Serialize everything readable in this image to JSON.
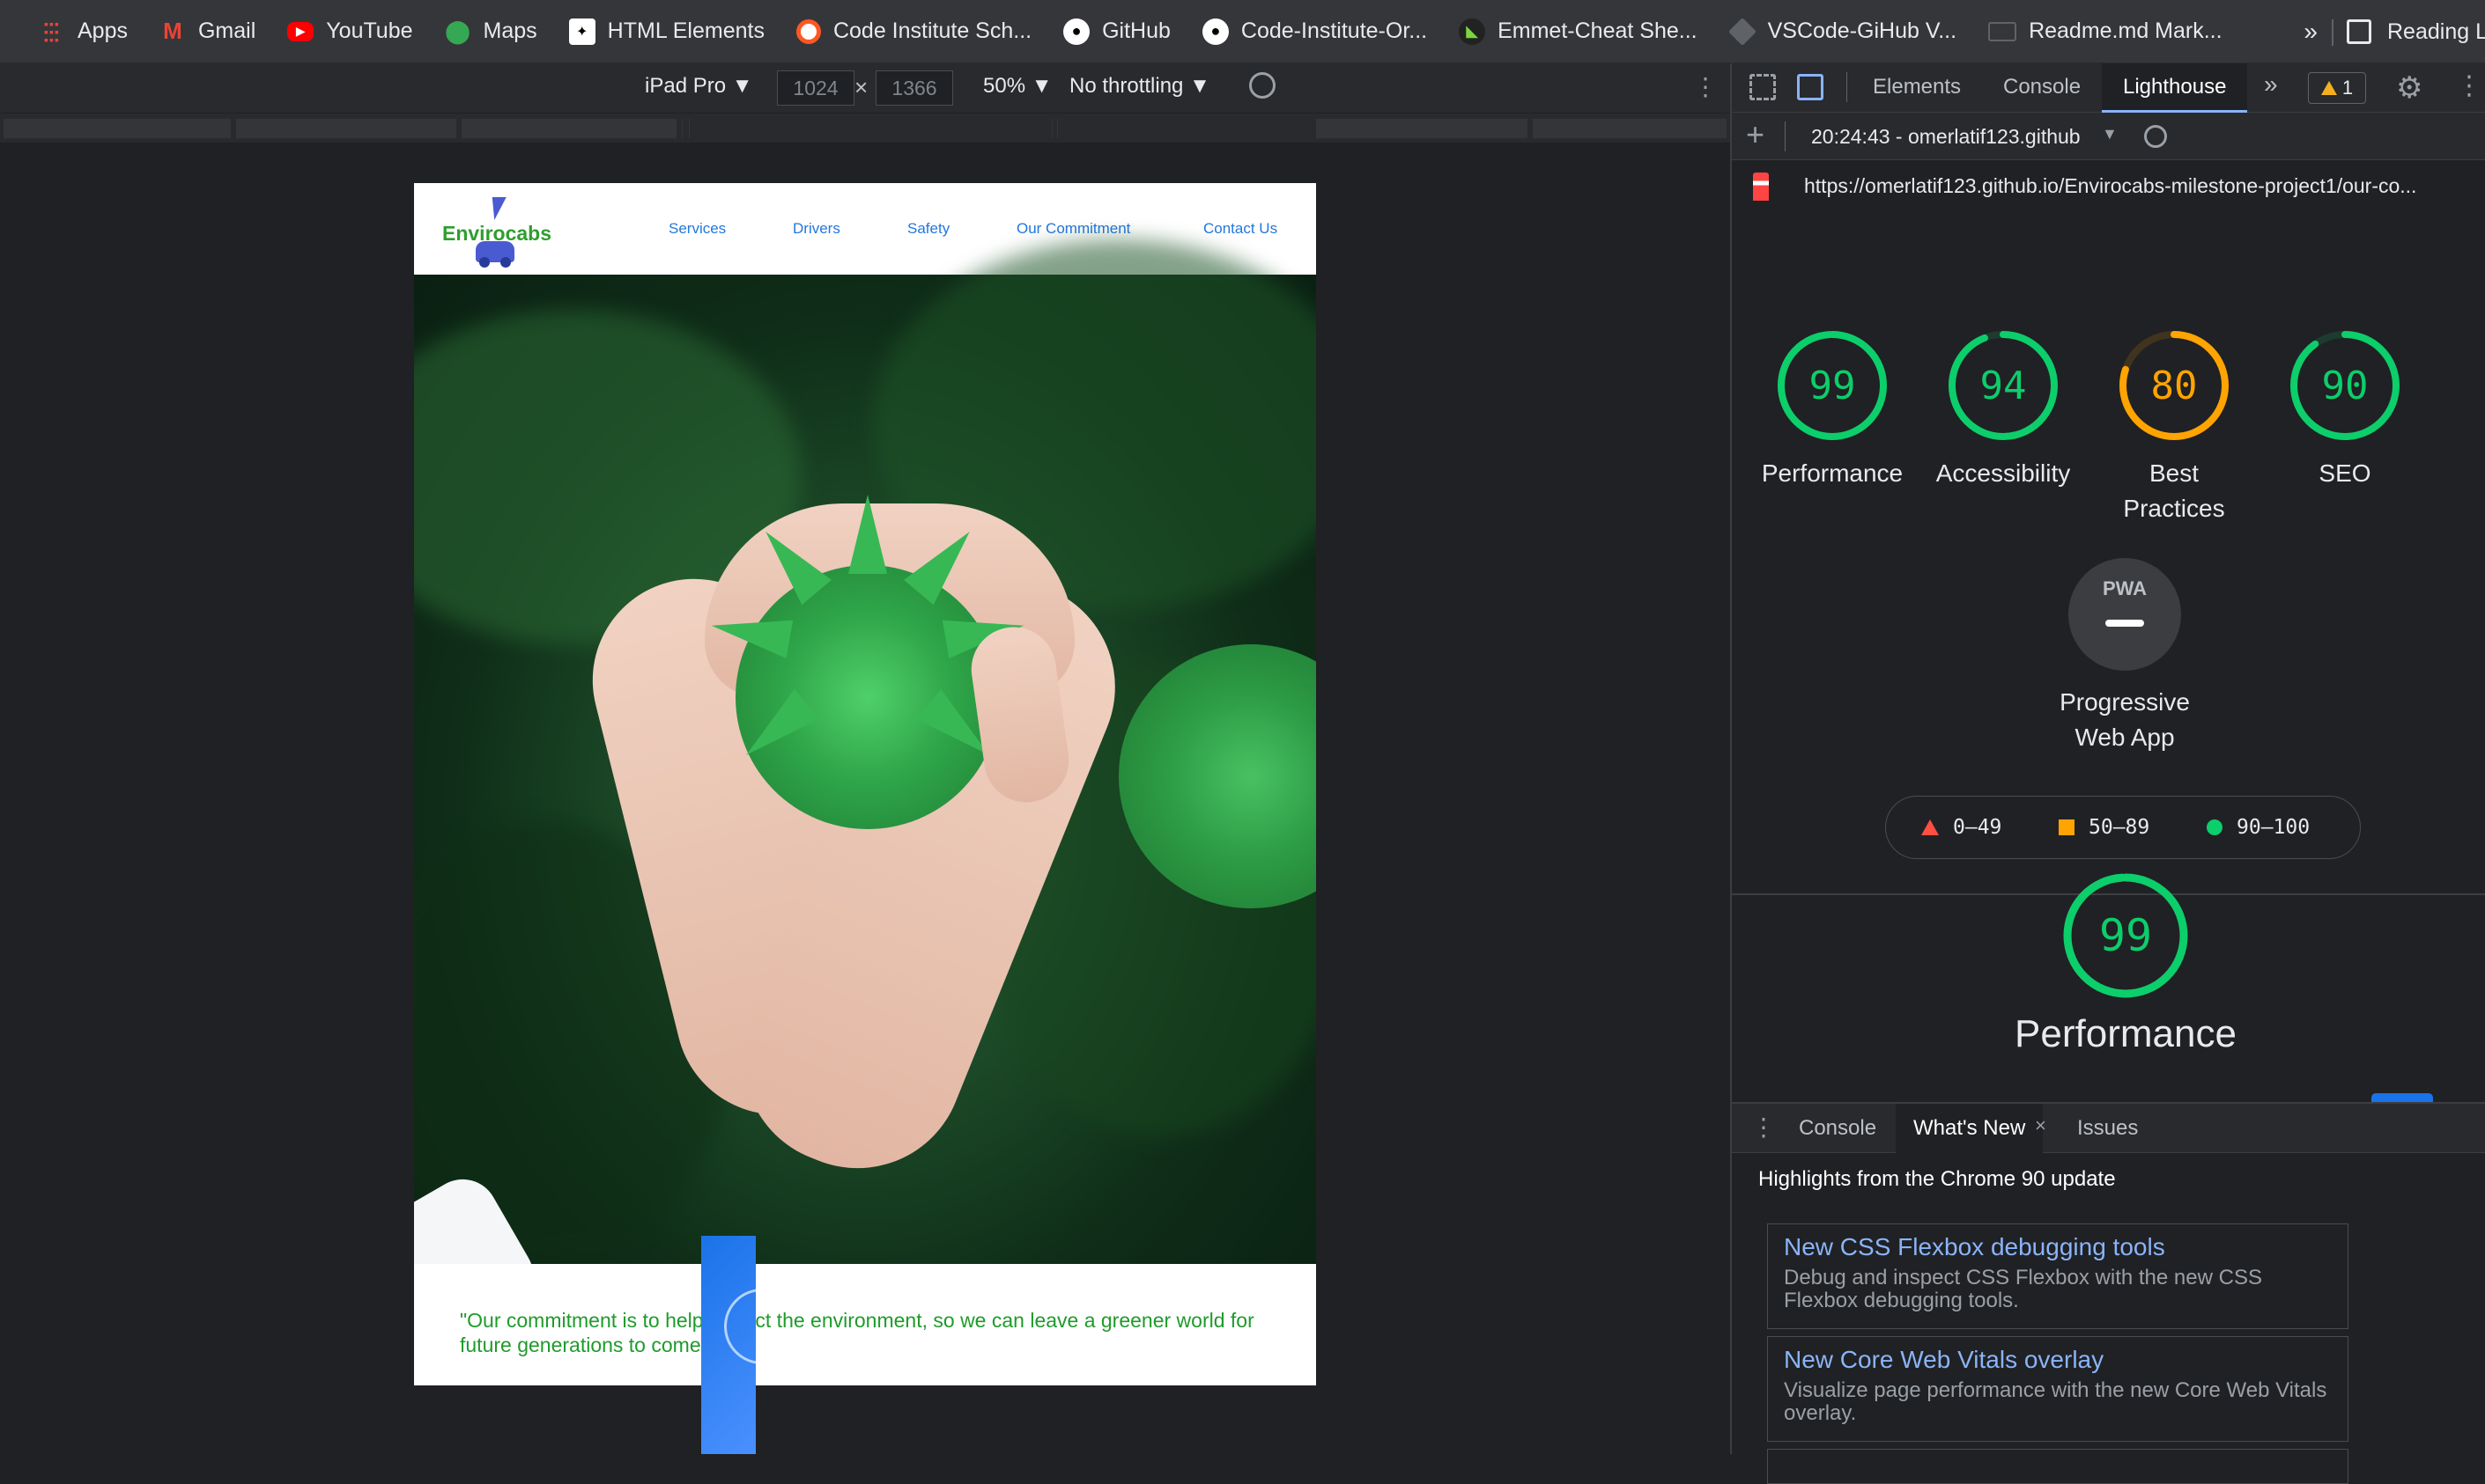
{
  "bookmarks": {
    "items": [
      {
        "label": "Apps",
        "icon": "apps-grid-icon",
        "color": "#ea4335"
      },
      {
        "label": "Gmail",
        "icon": "gmail-icon",
        "color": "#ea4335"
      },
      {
        "label": "YouTube",
        "icon": "youtube-icon",
        "color": "#ff0000"
      },
      {
        "label": "Maps",
        "icon": "maps-pin-icon",
        "color": "#34a853"
      },
      {
        "label": "HTML Elements",
        "icon": "html-icon",
        "color": "#ffffff"
      },
      {
        "label": "Code Institute Sch...",
        "icon": "code-institute-icon",
        "color": "#ff5722"
      },
      {
        "label": "GitHub",
        "icon": "github-icon",
        "color": "#ffffff"
      },
      {
        "label": "Code-Institute-Or...",
        "icon": "github-icon",
        "color": "#ffffff"
      },
      {
        "label": "Emmet-Cheat She...",
        "icon": "emmet-icon",
        "color": "#7cd63f"
      },
      {
        "label": "VSCode-GiHub V...",
        "icon": "cube-icon",
        "color": "#9aa0a6"
      },
      {
        "label": "Readme.md Mark...",
        "icon": "markdown-icon",
        "color": "#9aa0a6"
      }
    ],
    "more": "»",
    "reading_list": "Reading L"
  },
  "device_toolbar": {
    "device": "iPad Pro ▼",
    "width": "1024",
    "height": "1366",
    "times": "×",
    "zoom": "50% ▼",
    "throttling": "No throttling ▼"
  },
  "site": {
    "brand": "Envirocabs",
    "nav": [
      "Services",
      "Drivers",
      "Safety",
      "Our Commitment",
      "Contact Us"
    ],
    "quote": "\"Our commitment is to help protect the environment, so we can leave a greener world for future generations to come\"."
  },
  "devtools": {
    "tabs": [
      "Elements",
      "Console",
      "Lighthouse"
    ],
    "overflow": "»",
    "warnings": "1",
    "lighthouse_bar": {
      "time": "20:24:43 - omerlatif123.github",
      "caret": "▼"
    },
    "url": "https://omerlatif123.github.io/Envirocabs-milestone-project1/our-co...",
    "scores": [
      {
        "label": "Performance",
        "value": 99,
        "color": "#0cce6b"
      },
      {
        "label": "Accessibility",
        "value": 94,
        "color": "#0cce6b"
      },
      {
        "label": "Best Practices",
        "value": 80,
        "color": "#ffa400"
      },
      {
        "label": "SEO",
        "value": 90,
        "color": "#0cce6b"
      }
    ],
    "pwa": {
      "badge": "PWA",
      "label": "Progressive Web App"
    },
    "legend": [
      "0–49",
      "50–89",
      "90–100"
    ],
    "performance_big": {
      "value": 99,
      "label": "Performance",
      "color": "#0cce6b"
    },
    "drawer": {
      "tabs": [
        "Console",
        "What's New",
        "Issues"
      ],
      "close": "×",
      "highlights": "Highlights from the Chrome 90 update",
      "cards": [
        {
          "title": "New CSS Flexbox debugging tools",
          "desc": "Debug and inspect CSS Flexbox with the new CSS Flexbox debugging tools."
        },
        {
          "title": "New Core Web Vitals overlay",
          "desc": "Visualize page performance with the new Core Web Vitals overlay."
        }
      ]
    }
  }
}
